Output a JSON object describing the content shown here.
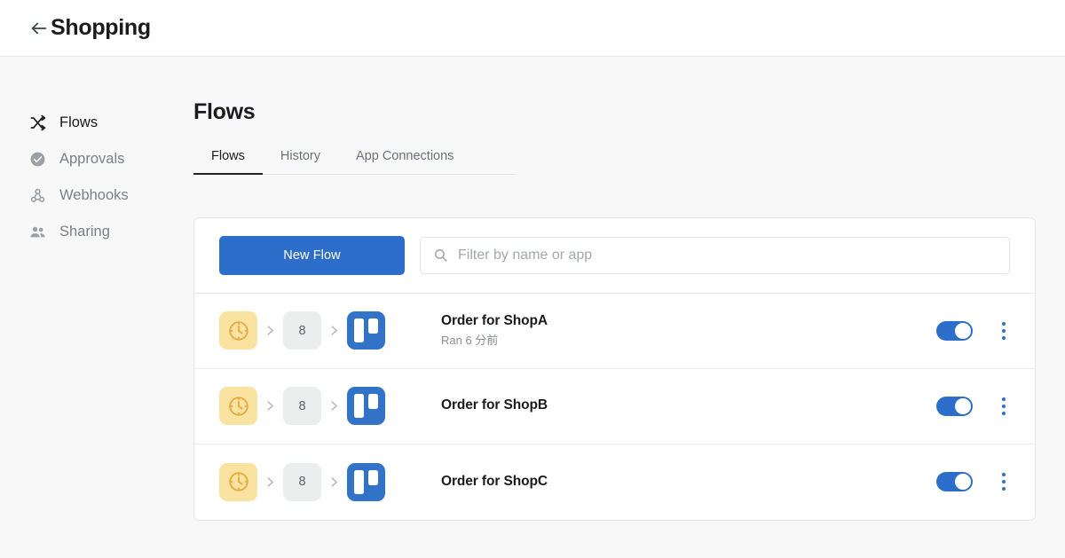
{
  "header": {
    "back_icon": "arrow-left-icon",
    "title": "Shopping"
  },
  "sidebar": {
    "items": [
      {
        "label": "Flows",
        "icon": "shuffle-icon",
        "active": true
      },
      {
        "label": "Approvals",
        "icon": "check-circle-icon",
        "active": false
      },
      {
        "label": "Webhooks",
        "icon": "webhook-icon",
        "active": false
      },
      {
        "label": "Sharing",
        "icon": "people-icon",
        "active": false
      }
    ]
  },
  "main": {
    "page_title": "Flows",
    "tabs": [
      {
        "label": "Flows",
        "active": true
      },
      {
        "label": "History",
        "active": false
      },
      {
        "label": "App Connections",
        "active": false
      }
    ],
    "toolbar": {
      "new_flow_label": "New Flow",
      "search_icon": "search-icon",
      "search_value": "",
      "search_placeholder": "Filter by name or app"
    },
    "flows": [
      {
        "name": "Order for ShopA",
        "status": "Ran 6 分前",
        "trigger_icon": "clock-icon",
        "step_count": "8",
        "action_icon": "trello-icon",
        "enabled": true,
        "menu_icon": "kebab-menu-icon"
      },
      {
        "name": "Order for ShopB",
        "status": "",
        "trigger_icon": "clock-icon",
        "step_count": "8",
        "action_icon": "trello-icon",
        "enabled": true,
        "menu_icon": "kebab-menu-icon"
      },
      {
        "name": "Order for ShopC",
        "status": "",
        "trigger_icon": "clock-icon",
        "step_count": "8",
        "action_icon": "trello-icon",
        "enabled": true,
        "menu_icon": "kebab-menu-icon"
      }
    ]
  },
  "colors": {
    "accent_blue": "#2d6ecb",
    "trello_blue": "#3273c8",
    "clock_tile": "#fae2a0",
    "clock_glyph": "#e8a93c",
    "page_bg": "#f8f8f9"
  }
}
